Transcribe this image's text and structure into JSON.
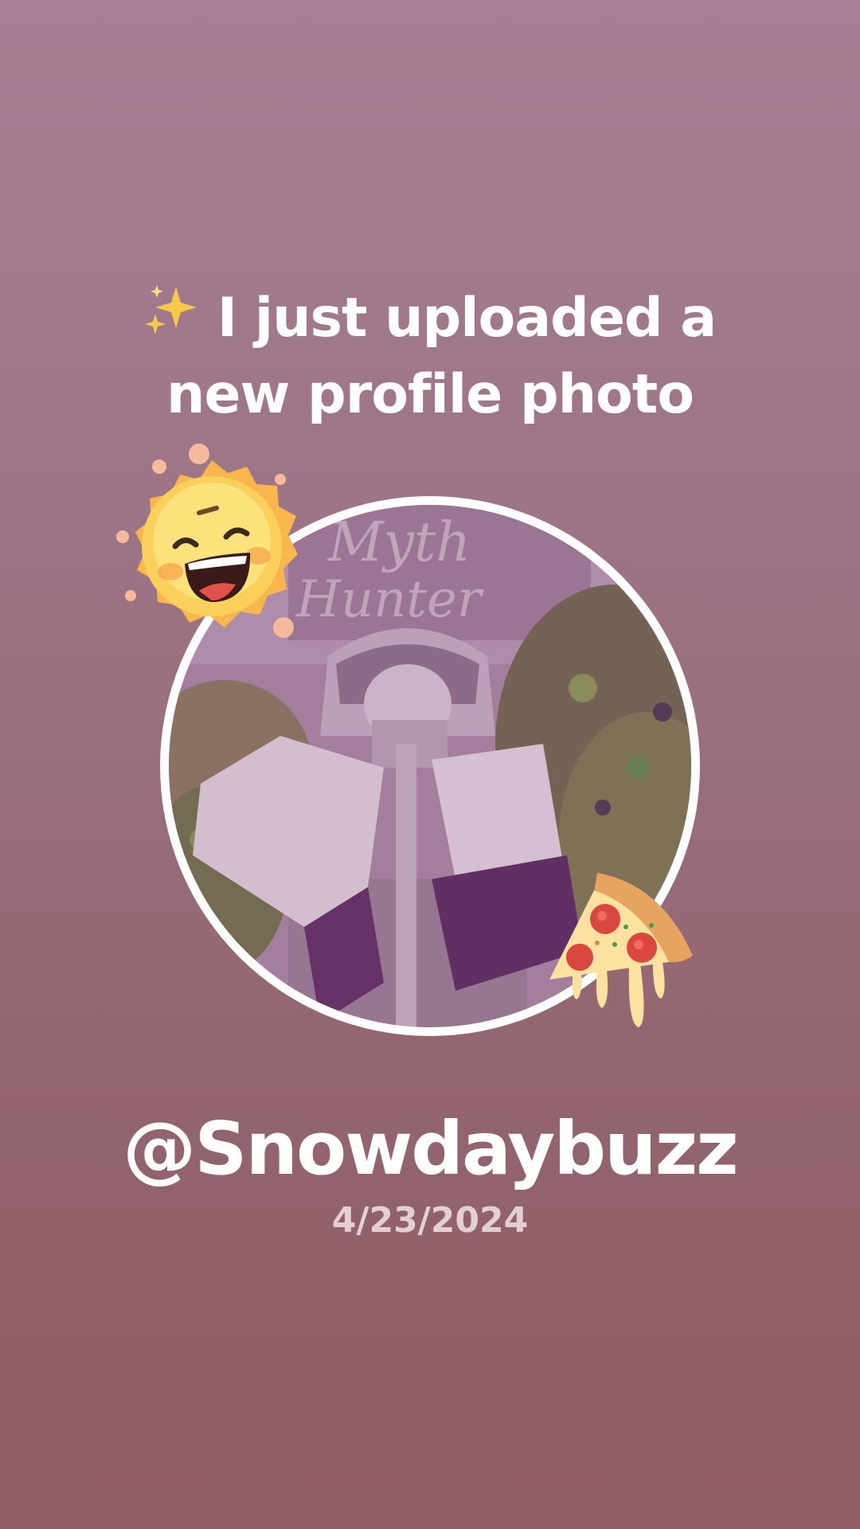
{
  "headline": {
    "icon": "sparkles-icon",
    "line1": "I just uploaded a",
    "line2": "new profile photo"
  },
  "profile_photo": {
    "sign_text_1": "Myth",
    "sign_text_2": "Hunter"
  },
  "stickers": {
    "top_left": "laughing-sun-icon",
    "bottom_right": "pizza-slice-icon"
  },
  "username": "@Snowdaybuzz",
  "date": "4/23/2024",
  "colors": {
    "background_top": "#a67f94",
    "background_bottom": "#8f5d63",
    "text": "#ffffff",
    "date_text": "#e3cfd6",
    "photo_border": "#ffffff"
  }
}
